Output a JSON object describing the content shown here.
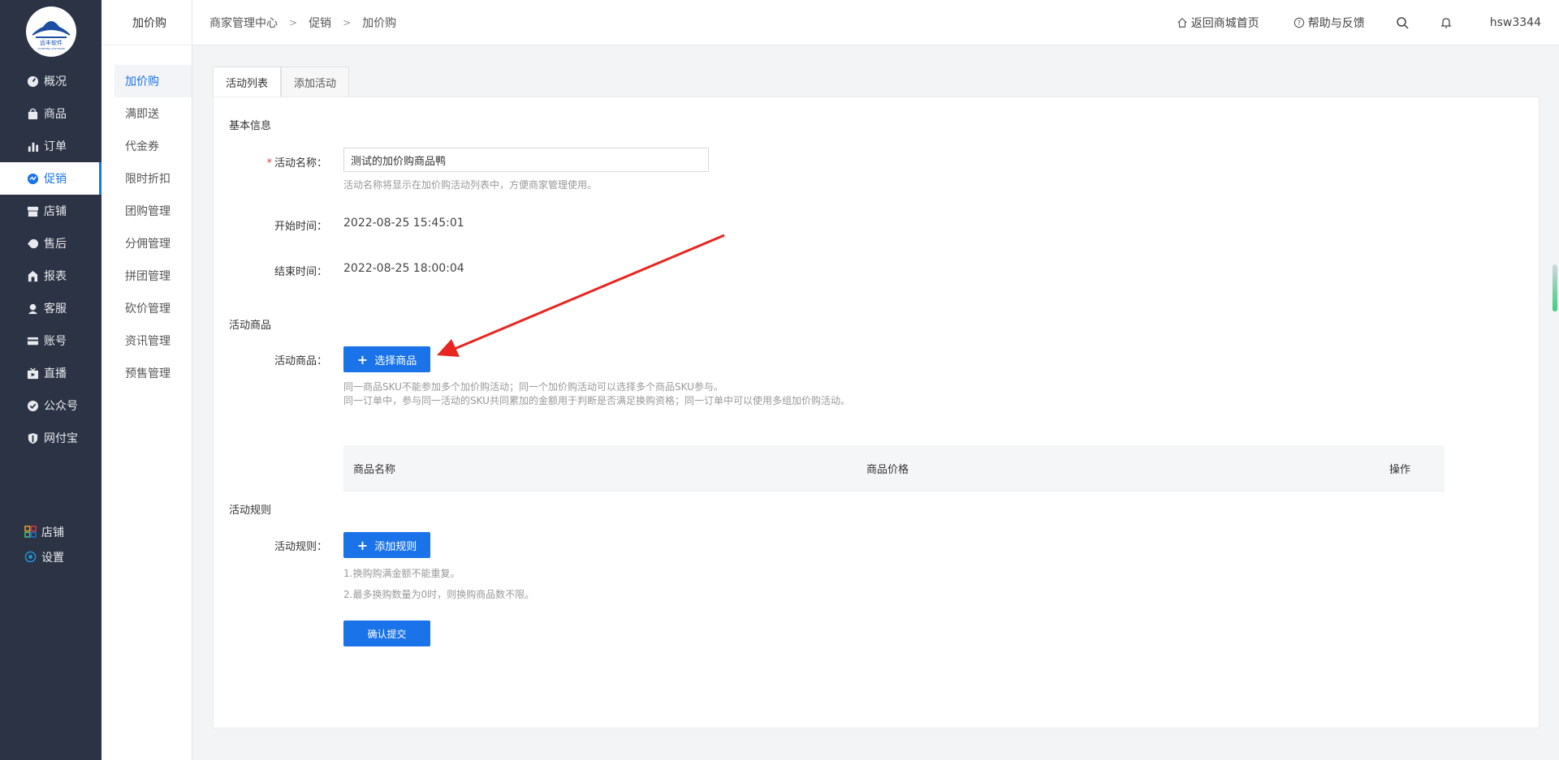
{
  "logo": {
    "text": "远丰软件",
    "subtext": "YUANFENG SOFTWARE"
  },
  "sidebar": {
    "items": [
      {
        "label": "概况",
        "icon": "dashboard-icon"
      },
      {
        "label": "商品",
        "icon": "bag-icon"
      },
      {
        "label": "订单",
        "icon": "bar-chart-icon"
      },
      {
        "label": "促销",
        "icon": "promo-icon",
        "active": true
      },
      {
        "label": "店铺",
        "icon": "store-icon"
      },
      {
        "label": "售后",
        "icon": "aftersale-icon"
      },
      {
        "label": "报表",
        "icon": "report-icon"
      },
      {
        "label": "客服",
        "icon": "service-icon"
      },
      {
        "label": "账号",
        "icon": "card-icon"
      },
      {
        "label": "直播",
        "icon": "live-icon"
      },
      {
        "label": "公众号",
        "icon": "badge-check-icon"
      },
      {
        "label": "网付宝",
        "icon": "shield-icon"
      }
    ],
    "bottom": [
      {
        "label": "店铺",
        "icon": "grid-icon"
      },
      {
        "label": "设置",
        "icon": "settings-icon"
      }
    ]
  },
  "subbar": {
    "title": "加价购",
    "items": [
      "加价购",
      "满即送",
      "代金券",
      "限时折扣",
      "团购管理",
      "分佣管理",
      "拼团管理",
      "砍价管理",
      "资讯管理",
      "预售管理"
    ]
  },
  "header": {
    "breadcrumb": [
      "商家管理中心",
      "促销",
      "加价购"
    ],
    "home_link": "返回商城首页",
    "help_link": "帮助与反馈",
    "username": "hsw3344"
  },
  "tabs": [
    "活动列表",
    "添加活动"
  ],
  "form": {
    "basic_title": "基本信息",
    "name_label": "活动名称：",
    "name_value": "测试的加价购商品鸭",
    "name_hint": "活动名称将显示在加价购活动列表中，方便商家管理使用。",
    "start_label": "开始时间：",
    "start_value": "2022-08-25 15:45:01",
    "end_label": "结束时间：",
    "end_value": "2022-08-25 18:00:04",
    "goods_title": "活动商品",
    "goods_label": "活动商品：",
    "select_goods_btn": "选择商品",
    "goods_hint1": "同一商品SKU不能参加多个加价购活动；同一个加价购活动可以选择多个商品SKU参与。",
    "goods_hint2": "同一订单中，参与同一活动的SKU共同累加的金额用于判断是否满足换购资格；同一订单中可以使用多组加价购活动。",
    "table_headers": [
      "商品名称",
      "商品价格",
      "操作"
    ],
    "rules_title": "活动规则",
    "rules_label": "活动规则：",
    "add_rule_btn": "添加规则",
    "rule_hint1": "1.换购购满金额不能重复。",
    "rule_hint2": "2.最多换购数量为0时，则换购商品数不限。",
    "submit_btn": "确认提交"
  },
  "colors": {
    "primary": "#1a73e8",
    "sidebar_bg": "#2c3344",
    "required": "#e4393c",
    "annotation": "#e8251f"
  }
}
